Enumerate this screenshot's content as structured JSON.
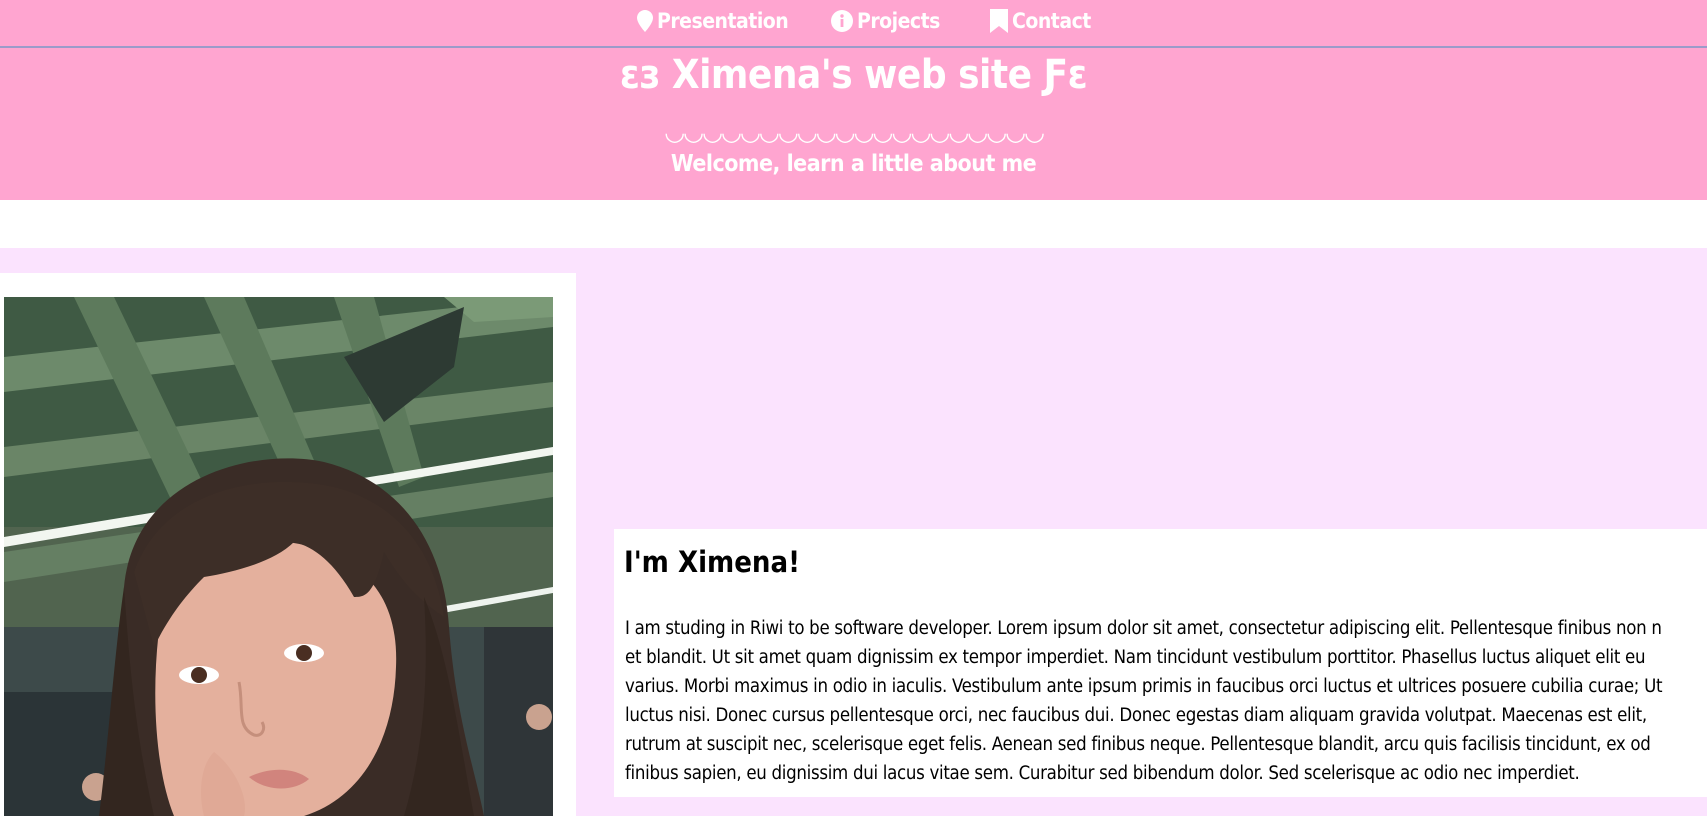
{
  "nav": {
    "items": [
      {
        "label": "Presentation",
        "icon": "map-marker-icon"
      },
      {
        "label": "Projects",
        "icon": "info-circle-icon"
      },
      {
        "label": "Contact",
        "icon": "bookmark-icon"
      }
    ]
  },
  "header": {
    "title": "εз Ximena's web site Ƒε",
    "divider": "◡◡◡◡◡◡◡◡◡◡◡◡◡◡◡◡◡◡◡◡",
    "subtitle": "Welcome, learn a little about me"
  },
  "profile": {
    "photo_alt": "Selfie of Ximena under a green steel roof structure"
  },
  "bio": {
    "heading": "I'm Ximena!",
    "lines": [
      "I am studing in Riwi to be software developer. Lorem ipsum dolor sit amet, consectetur adipiscing elit. Pellentesque finibus non n",
      "et blandit. Ut sit amet quam dignissim ex tempor imperdiet. Nam tincidunt vestibulum porttitor. Phasellus luctus aliquet elit eu",
      "varius. Morbi maximus in odio in iaculis. Vestibulum ante ipsum primis in faucibus orci luctus et ultrices posuere cubilia curae; Ut",
      "luctus nisi. Donec cursus pellentesque orci, nec faucibus dui. Donec egestas diam aliquam gravida volutpat. Maecenas est elit,",
      "rutrum at suscipit nec, scelerisque eget felis. Aenean sed finibus neque. Pellentesque blandit, arcu quis facilisis tincidunt, ex od",
      "finibus sapien, eu dignissim dui lacus vitae sem. Curabitur sed bibendum dolor. Sed scelerisque ac odio nec imperdiet."
    ]
  },
  "colors": {
    "header_pink": "#ffa5d0",
    "main_lilac": "#fbe3fe",
    "nav_border": "#9b9bc9"
  }
}
